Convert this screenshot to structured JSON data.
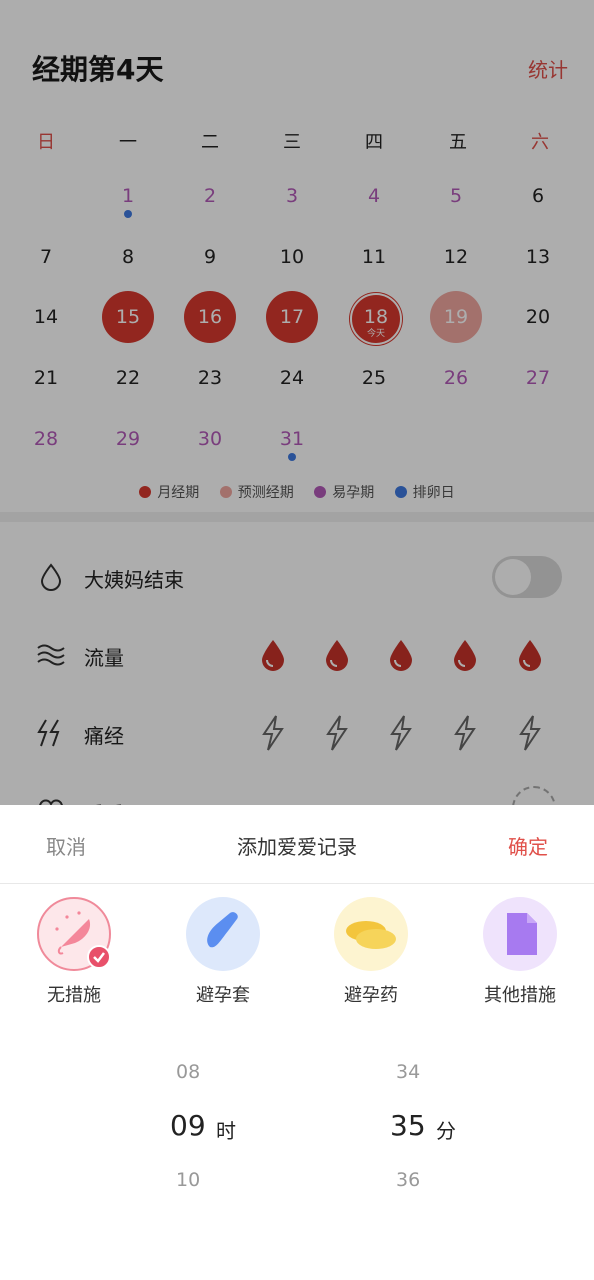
{
  "header": {
    "title": "经期第4天",
    "stats_label": "统计"
  },
  "calendar": {
    "weekdays": [
      "日",
      "一",
      "二",
      "三",
      "四",
      "五",
      "六"
    ],
    "rows": [
      [
        "",
        "1",
        "2",
        "3",
        "4",
        "5",
        "6"
      ],
      [
        "7",
        "8",
        "9",
        "10",
        "11",
        "12",
        "13"
      ],
      [
        "14",
        "15",
        "16",
        "17",
        "18",
        "19",
        "20"
      ],
      [
        "21",
        "22",
        "23",
        "24",
        "25",
        "26",
        "27"
      ],
      [
        "28",
        "29",
        "30",
        "31",
        "",
        "",
        ""
      ]
    ],
    "today_sub": "今天"
  },
  "legend": [
    {
      "label": "月经期",
      "color": "#d8382e"
    },
    {
      "label": "预测经期",
      "color": "#f0a7a0"
    },
    {
      "label": "易孕期",
      "color": "#b35ab8"
    },
    {
      "label": "排卵日",
      "color": "#3f7ae0"
    }
  ],
  "records": {
    "end_label": "大姨妈结束",
    "end_toggle_on": false,
    "flow_label": "流量",
    "pain_label": "痛经",
    "love_label": "爱爱"
  },
  "sheet": {
    "cancel": "取消",
    "title": "添加爱爱记录",
    "confirm": "确定",
    "options": [
      {
        "label": "无措施",
        "icon": "no-protection-icon",
        "selected": true
      },
      {
        "label": "避孕套",
        "icon": "condom-icon",
        "selected": false
      },
      {
        "label": "避孕药",
        "icon": "pill-icon",
        "selected": false
      },
      {
        "label": "其他措施",
        "icon": "other-measures-icon",
        "selected": false
      }
    ],
    "hour": {
      "prev": "08",
      "value": "09",
      "next": "10",
      "unit": "时"
    },
    "minute": {
      "prev": "34",
      "value": "35",
      "next": "36",
      "unit": "分"
    }
  }
}
